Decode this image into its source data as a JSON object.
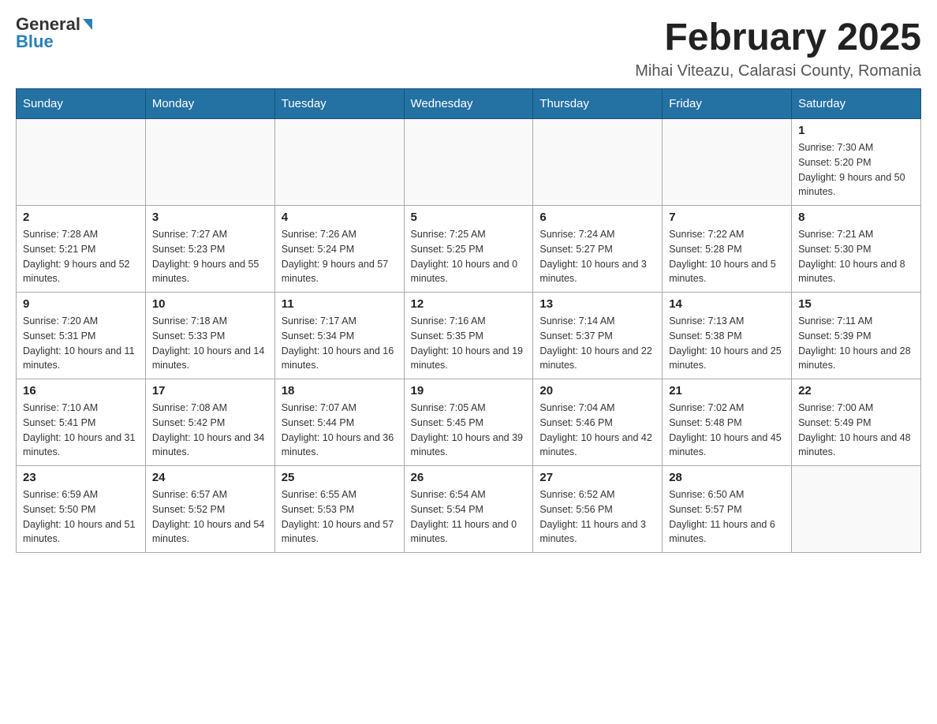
{
  "header": {
    "logo_general": "General",
    "logo_blue": "Blue",
    "title": "February 2025",
    "subtitle": "Mihai Viteazu, Calarasi County, Romania"
  },
  "days_of_week": [
    "Sunday",
    "Monday",
    "Tuesday",
    "Wednesday",
    "Thursday",
    "Friday",
    "Saturday"
  ],
  "weeks": [
    [
      {
        "day": "",
        "info": ""
      },
      {
        "day": "",
        "info": ""
      },
      {
        "day": "",
        "info": ""
      },
      {
        "day": "",
        "info": ""
      },
      {
        "day": "",
        "info": ""
      },
      {
        "day": "",
        "info": ""
      },
      {
        "day": "1",
        "info": "Sunrise: 7:30 AM\nSunset: 5:20 PM\nDaylight: 9 hours and 50 minutes."
      }
    ],
    [
      {
        "day": "2",
        "info": "Sunrise: 7:28 AM\nSunset: 5:21 PM\nDaylight: 9 hours and 52 minutes."
      },
      {
        "day": "3",
        "info": "Sunrise: 7:27 AM\nSunset: 5:23 PM\nDaylight: 9 hours and 55 minutes."
      },
      {
        "day": "4",
        "info": "Sunrise: 7:26 AM\nSunset: 5:24 PM\nDaylight: 9 hours and 57 minutes."
      },
      {
        "day": "5",
        "info": "Sunrise: 7:25 AM\nSunset: 5:25 PM\nDaylight: 10 hours and 0 minutes."
      },
      {
        "day": "6",
        "info": "Sunrise: 7:24 AM\nSunset: 5:27 PM\nDaylight: 10 hours and 3 minutes."
      },
      {
        "day": "7",
        "info": "Sunrise: 7:22 AM\nSunset: 5:28 PM\nDaylight: 10 hours and 5 minutes."
      },
      {
        "day": "8",
        "info": "Sunrise: 7:21 AM\nSunset: 5:30 PM\nDaylight: 10 hours and 8 minutes."
      }
    ],
    [
      {
        "day": "9",
        "info": "Sunrise: 7:20 AM\nSunset: 5:31 PM\nDaylight: 10 hours and 11 minutes."
      },
      {
        "day": "10",
        "info": "Sunrise: 7:18 AM\nSunset: 5:33 PM\nDaylight: 10 hours and 14 minutes."
      },
      {
        "day": "11",
        "info": "Sunrise: 7:17 AM\nSunset: 5:34 PM\nDaylight: 10 hours and 16 minutes."
      },
      {
        "day": "12",
        "info": "Sunrise: 7:16 AM\nSunset: 5:35 PM\nDaylight: 10 hours and 19 minutes."
      },
      {
        "day": "13",
        "info": "Sunrise: 7:14 AM\nSunset: 5:37 PM\nDaylight: 10 hours and 22 minutes."
      },
      {
        "day": "14",
        "info": "Sunrise: 7:13 AM\nSunset: 5:38 PM\nDaylight: 10 hours and 25 minutes."
      },
      {
        "day": "15",
        "info": "Sunrise: 7:11 AM\nSunset: 5:39 PM\nDaylight: 10 hours and 28 minutes."
      }
    ],
    [
      {
        "day": "16",
        "info": "Sunrise: 7:10 AM\nSunset: 5:41 PM\nDaylight: 10 hours and 31 minutes."
      },
      {
        "day": "17",
        "info": "Sunrise: 7:08 AM\nSunset: 5:42 PM\nDaylight: 10 hours and 34 minutes."
      },
      {
        "day": "18",
        "info": "Sunrise: 7:07 AM\nSunset: 5:44 PM\nDaylight: 10 hours and 36 minutes."
      },
      {
        "day": "19",
        "info": "Sunrise: 7:05 AM\nSunset: 5:45 PM\nDaylight: 10 hours and 39 minutes."
      },
      {
        "day": "20",
        "info": "Sunrise: 7:04 AM\nSunset: 5:46 PM\nDaylight: 10 hours and 42 minutes."
      },
      {
        "day": "21",
        "info": "Sunrise: 7:02 AM\nSunset: 5:48 PM\nDaylight: 10 hours and 45 minutes."
      },
      {
        "day": "22",
        "info": "Sunrise: 7:00 AM\nSunset: 5:49 PM\nDaylight: 10 hours and 48 minutes."
      }
    ],
    [
      {
        "day": "23",
        "info": "Sunrise: 6:59 AM\nSunset: 5:50 PM\nDaylight: 10 hours and 51 minutes."
      },
      {
        "day": "24",
        "info": "Sunrise: 6:57 AM\nSunset: 5:52 PM\nDaylight: 10 hours and 54 minutes."
      },
      {
        "day": "25",
        "info": "Sunrise: 6:55 AM\nSunset: 5:53 PM\nDaylight: 10 hours and 57 minutes."
      },
      {
        "day": "26",
        "info": "Sunrise: 6:54 AM\nSunset: 5:54 PM\nDaylight: 11 hours and 0 minutes."
      },
      {
        "day": "27",
        "info": "Sunrise: 6:52 AM\nSunset: 5:56 PM\nDaylight: 11 hours and 3 minutes."
      },
      {
        "day": "28",
        "info": "Sunrise: 6:50 AM\nSunset: 5:57 PM\nDaylight: 11 hours and 6 minutes."
      },
      {
        "day": "",
        "info": ""
      }
    ]
  ]
}
